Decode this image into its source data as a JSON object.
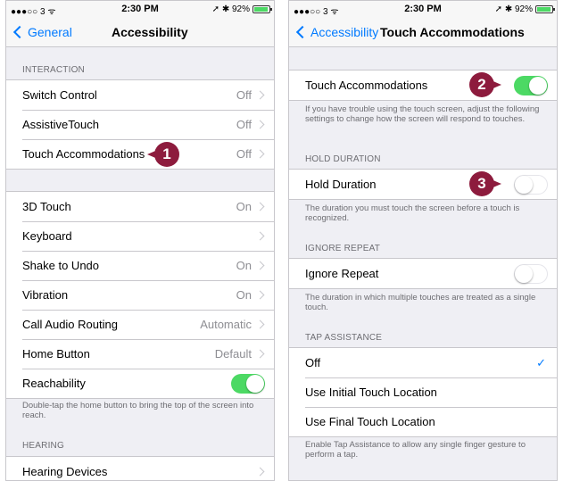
{
  "left": {
    "status": {
      "carrier": "●●●○○ 3 ᯤ",
      "time": "2:30 PM",
      "right": "➚ ✱ 92%"
    },
    "nav": {
      "back": "General",
      "title": "Accessibility"
    },
    "interaction_header": "INTERACTION",
    "interaction_rows": [
      {
        "label": "Switch Control",
        "value": "Off"
      },
      {
        "label": "AssistiveTouch",
        "value": "Off"
      },
      {
        "label": "Touch Accommodations",
        "value": "Off"
      }
    ],
    "second_rows": [
      {
        "label": "3D Touch",
        "value": "On"
      },
      {
        "label": "Keyboard",
        "value": ""
      },
      {
        "label": "Shake to Undo",
        "value": "On"
      },
      {
        "label": "Vibration",
        "value": "On"
      },
      {
        "label": "Call Audio Routing",
        "value": "Automatic"
      },
      {
        "label": "Home Button",
        "value": "Default"
      },
      {
        "label": "Reachability",
        "value": ""
      }
    ],
    "reachability_on": true,
    "reachability_footer": "Double-tap the home button to bring the top of the screen into reach.",
    "hearing_header": "HEARING",
    "hearing_rows": [
      {
        "label": "Hearing Devices",
        "value": ""
      }
    ],
    "callout": "1"
  },
  "right": {
    "status": {
      "carrier": "●●●○○ 3 ᯤ",
      "time": "2:30 PM",
      "right": "➚ ✱ 92%"
    },
    "nav": {
      "back": "Accessibility",
      "title": "Touch Accommodations"
    },
    "touch_accommodations": {
      "label": "Touch Accommodations",
      "on": true
    },
    "touch_footer": "If you have trouble using the touch screen, adjust the following settings to change how the screen will respond to touches.",
    "hold_header": "HOLD DURATION",
    "hold_duration": {
      "label": "Hold Duration",
      "on": false
    },
    "hold_footer": "The duration you must touch the screen before a touch is recognized.",
    "ignore_header": "IGNORE REPEAT",
    "ignore_repeat": {
      "label": "Ignore Repeat",
      "on": false
    },
    "ignore_footer": "The duration in which multiple touches are treated as a single touch.",
    "tap_header": "TAP ASSISTANCE",
    "tap_rows": [
      {
        "label": "Off",
        "selected": true
      },
      {
        "label": "Use Initial Touch Location",
        "selected": false
      },
      {
        "label": "Use Final Touch Location",
        "selected": false
      }
    ],
    "tap_footer": "Enable Tap Assistance to allow any single finger gesture to perform a tap.",
    "callout_2": "2",
    "callout_3": "3"
  },
  "colors": {
    "accent": "#007aff",
    "toggle_on": "#4cd964",
    "callout": "#8d1b3d",
    "background": "#efeff4"
  }
}
